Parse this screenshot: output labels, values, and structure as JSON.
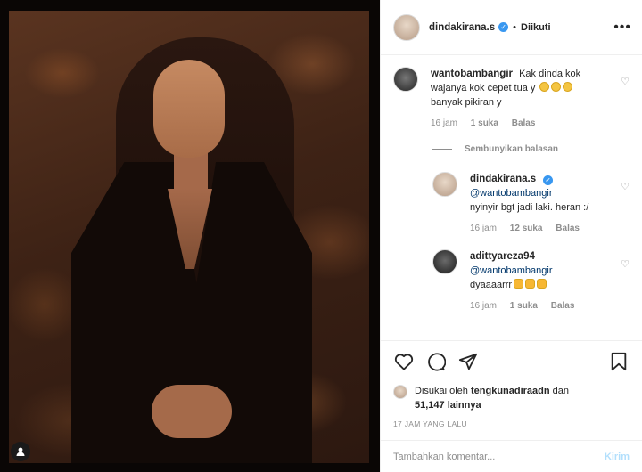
{
  "post": {
    "author": "dindakirana.s",
    "follow_state": "Diikuti",
    "dot": "•",
    "more": "•••"
  },
  "comments": [
    {
      "username": "wantobambangir",
      "text": "Kak dinda kok wajanya kok cepet tua y",
      "text2": "banyak pikiran y",
      "time": "16 jam",
      "likes": "1 suka",
      "reply": "Balas"
    }
  ],
  "hide_replies": "Sembunyikan balasan",
  "replies": [
    {
      "username": "dindakirana.s",
      "mention": "@wantobambangir",
      "text": "nyinyir bgt jadi laki. heran :/",
      "time": "16 jam",
      "likes": "12 suka",
      "reply": "Balas"
    },
    {
      "username": "adittyareza94",
      "mention": "@wantobambangir",
      "text": "dyaaaarrr",
      "time": "16 jam",
      "likes": "1 suka",
      "reply": "Balas"
    }
  ],
  "likes": {
    "prefix": "Disukai oleh",
    "user": "tengkunadiraadn",
    "middle": "dan",
    "count": "51,147 lainnya"
  },
  "time_ago": "17 JAM YANG LALU",
  "add_comment": {
    "placeholder": "Tambahkan komentar...",
    "post_label": "Kirim"
  },
  "icons": {
    "like": "heart-icon",
    "comment": "comment-icon",
    "share": "share-icon",
    "save": "bookmark-icon",
    "user_tag": "user-tag-icon"
  },
  "colors": {
    "verified": "#3897f0",
    "mention": "#00376b",
    "muted": "#8e8e8e",
    "post_disabled": "#b2dffc"
  }
}
